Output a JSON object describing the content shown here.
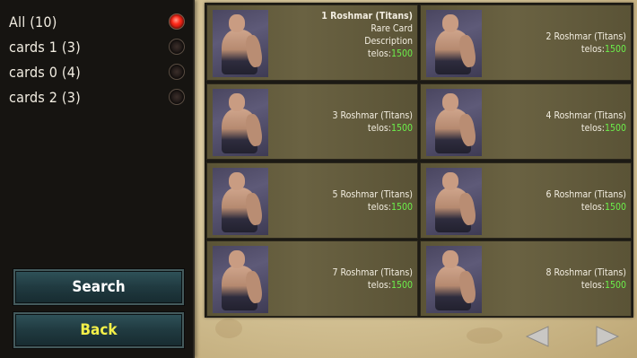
{
  "filters": [
    {
      "label": "All  (10)",
      "selected": true
    },
    {
      "label": "cards 1   (3)",
      "selected": false
    },
    {
      "label": "cards 0   (4)",
      "selected": false
    },
    {
      "label": "cards 2   (3)",
      "selected": false
    }
  ],
  "buttons": {
    "search": "Search",
    "back": "Back"
  },
  "cards": [
    {
      "name": "1 Roshmar (Titans)",
      "rarity": "Rare Card",
      "description": "Description",
      "price_label": "telos:",
      "price": "1500"
    },
    {
      "name": "2 Roshmar (Titans)",
      "price_label": "telos:",
      "price": "1500"
    },
    {
      "name": "3 Roshmar (Titans)",
      "price_label": "telos:",
      "price": "1500"
    },
    {
      "name": "4 Roshmar (Titans)",
      "price_label": "telos:",
      "price": "1500"
    },
    {
      "name": "5 Roshmar (Titans)",
      "price_label": "telos:",
      "price": "1500"
    },
    {
      "name": "6 Roshmar (Titans)",
      "price_label": "telos:",
      "price": "1500"
    },
    {
      "name": "7 Roshmar (Titans)",
      "price_label": "telos:",
      "price": "1500"
    },
    {
      "name": "8 Roshmar (Titans)",
      "price_label": "telos:",
      "price": "1500"
    }
  ],
  "colors": {
    "price": "#6cf04b",
    "back_label": "#f4f049",
    "search_label": "#ffffff",
    "radio_active": "#ff2a1a"
  },
  "icons": {
    "prev": "left-arrow-icon",
    "next": "right-arrow-icon"
  }
}
